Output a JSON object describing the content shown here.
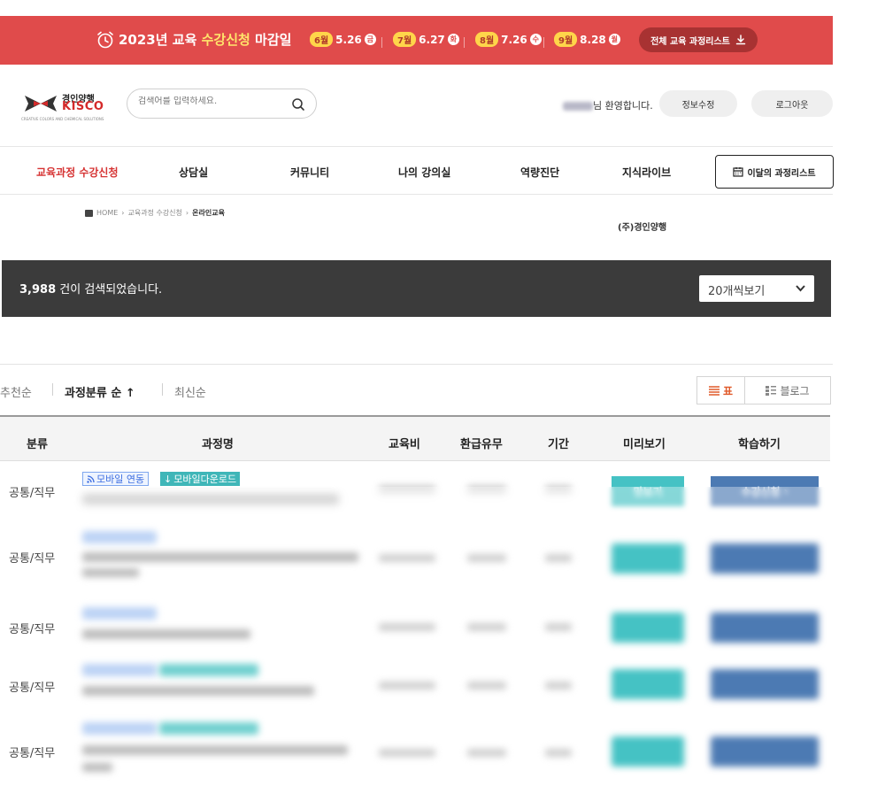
{
  "banner": {
    "title_prefix": "2023년 교육",
    "title_highlight": "수강신청",
    "title_suffix": "마감일",
    "deadlines": [
      {
        "month": "6월",
        "date": "5.26",
        "dow": "금"
      },
      {
        "month": "7월",
        "date": "6.27",
        "dow": "화"
      },
      {
        "month": "8월",
        "date": "7.26",
        "dow": "수"
      },
      {
        "month": "9월",
        "date": "8.28",
        "dow": "월"
      }
    ],
    "download_all_label": "전체 교육 과정리스트"
  },
  "header": {
    "logo_line1": "경인양행",
    "logo_line2": "KISCO",
    "logo_tagline": "CREATIVE COLORS AND CHEMICAL SOLUTIONS",
    "search_placeholder": "검색어를 입력하세요.",
    "welcome_suffix": "님 환영합니다.",
    "edit_profile_label": "정보수정",
    "logout_label": "로그아웃"
  },
  "nav": {
    "items": [
      "교육과정 수강신청",
      "상담실",
      "커뮤니티",
      "나의 강의실",
      "역량진단",
      "지식라이브"
    ],
    "month_list_label": "이달의 과정리스트"
  },
  "breadcrumb": {
    "items": [
      "HOME",
      "교육과정 수강신청",
      "온라인교육"
    ],
    "company": "(주)경인양행"
  },
  "results": {
    "count": "3,988",
    "count_suffix": "건이 검색되었습니다.",
    "per_page": "20개씩보기"
  },
  "sort": {
    "options": [
      "추천순",
      "과정분류 순 ↑",
      "최신순"
    ],
    "view_table": "표",
    "view_blog": "블로그"
  },
  "table": {
    "headers": [
      "분류",
      "과정명",
      "교육비",
      "환급유무",
      "기간",
      "미리보기",
      "학습하기"
    ],
    "rows": [
      {
        "category": "공통/직무",
        "tag_mobile": "모바일 연동",
        "tag_download": "모바일다운로드",
        "preview_label": "맛보기",
        "learn_label": "수강신청"
      },
      {
        "category": "공통/직무"
      },
      {
        "category": "공통/직무"
      },
      {
        "category": "공통/직무"
      },
      {
        "category": "공통/직무"
      }
    ]
  },
  "colors": {
    "banner_red": "#e04b4b",
    "accent_yellow": "#ffe46b",
    "nav_active": "#d63333",
    "preview_teal": "#45c2c4",
    "learn_blue": "#4c7ab3",
    "result_bar": "#3b3b3b"
  }
}
